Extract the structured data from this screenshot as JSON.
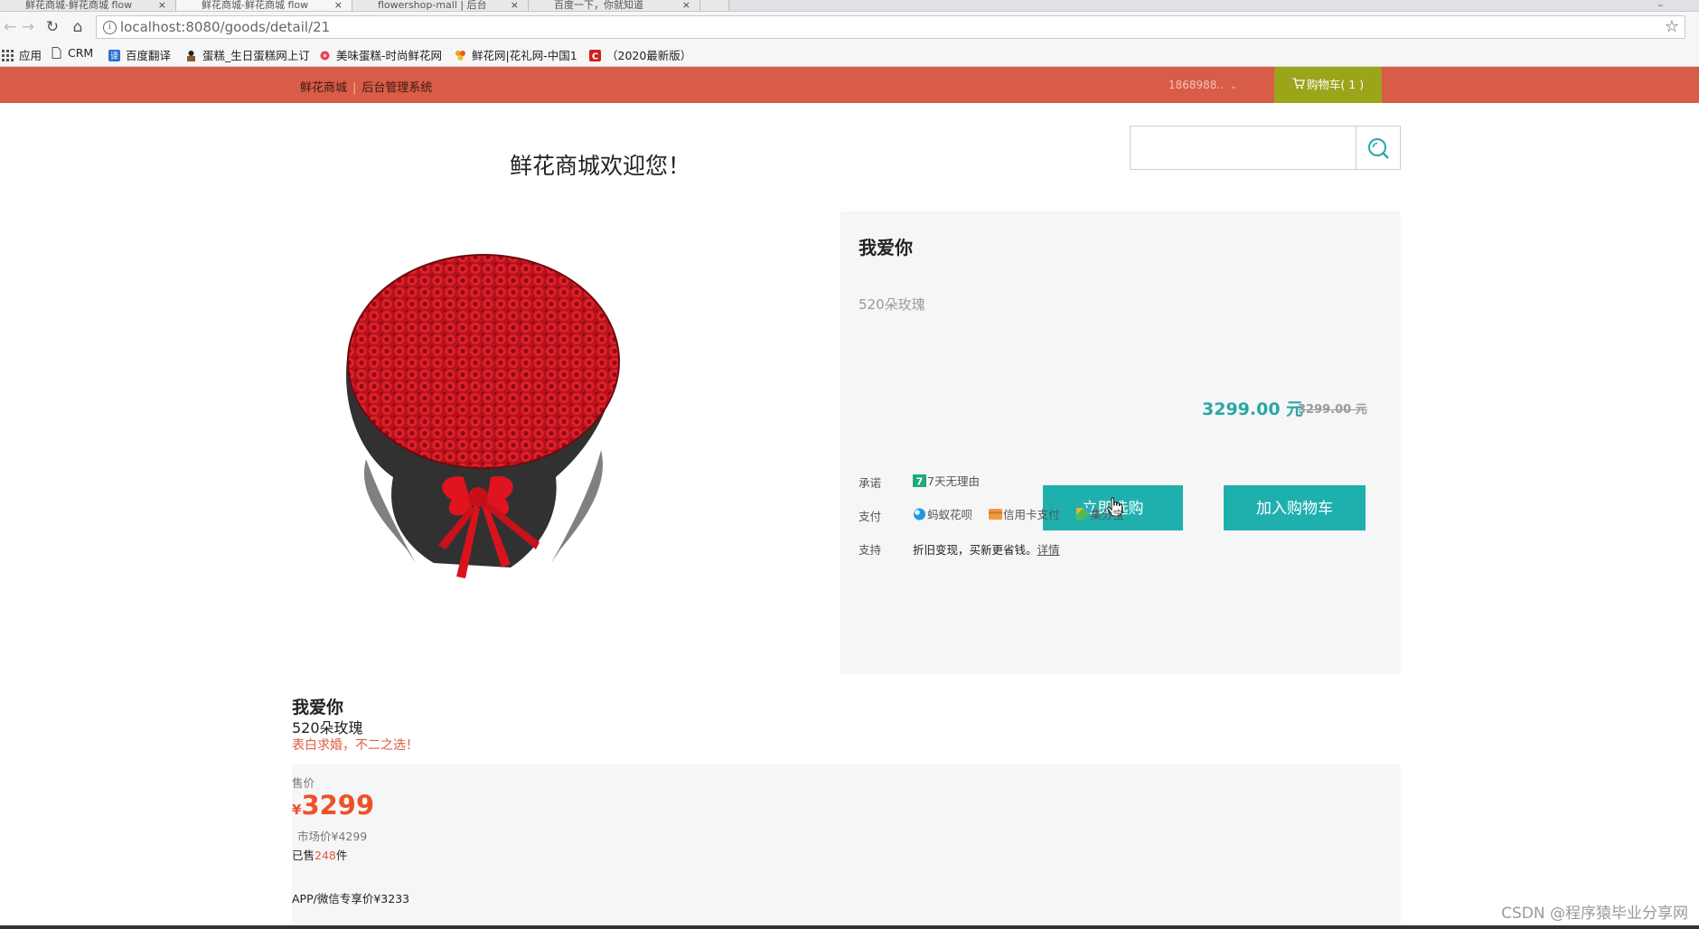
{
  "browser": {
    "tabs": [
      {
        "title": "鲜花商城-鲜花商城 flow"
      },
      {
        "title": "鲜花商城-鲜花商城 flow"
      },
      {
        "title": "flowershop-mall | 后台"
      },
      {
        "title": "百度一下，你就知道"
      }
    ],
    "url": "localhost:8080/goods/detail/21",
    "bookmarks": [
      {
        "label": "应用"
      },
      {
        "label": "CRM"
      },
      {
        "label": "百度翻译"
      },
      {
        "label": "蛋糕_生日蛋糕网上订"
      },
      {
        "label": "美味蛋糕-时尚鲜花网"
      },
      {
        "label": "鲜花网|花礼网-中国1"
      },
      {
        "label": "（2020最新版）"
      }
    ]
  },
  "header": {
    "shop_link": "鲜花商城",
    "separator": "|",
    "admin_link": "后台管理系统",
    "user": "1868988..",
    "cart_label": "购物车( 1 )"
  },
  "welcome": "鲜花商城欢迎您！",
  "search": {
    "placeholder": ""
  },
  "product": {
    "name": "我爱你",
    "desc": "520朵玫瑰",
    "price": "3299.00 元",
    "old_price": "3299.00 元",
    "buy_now": "立即选购",
    "add_to_cart": "加入购物车",
    "services": {
      "promise_label": "承诺",
      "promise_value": "7天无理由",
      "pay_label": "支付",
      "pay_items": [
        "蚂蚁花呗",
        "信用卡支付",
        "集分宝"
      ],
      "support_label": "支持",
      "support_text": "折旧变现，买新更省钱。",
      "support_link": "详情"
    }
  },
  "summary": {
    "name": "我爱你",
    "desc": "520朵玫瑰",
    "promo": "表白求婚，不二之选！",
    "price_label": "售价",
    "currency": "¥",
    "price": "3299",
    "market_price": "市场价¥4299",
    "sold_prefix": "已售",
    "sold_count": "248",
    "sold_suffix": "件",
    "app_price": "APP/微信专享价¥3233"
  },
  "watermark": "CSDN @程序猿毕业分享网",
  "colors": {
    "header_bg": "#d85c47",
    "cart_bg": "#9aa51a",
    "accent_teal": "#1fb0ae",
    "price_teal": "#2aa7a6",
    "price_red": "#ee5129"
  }
}
